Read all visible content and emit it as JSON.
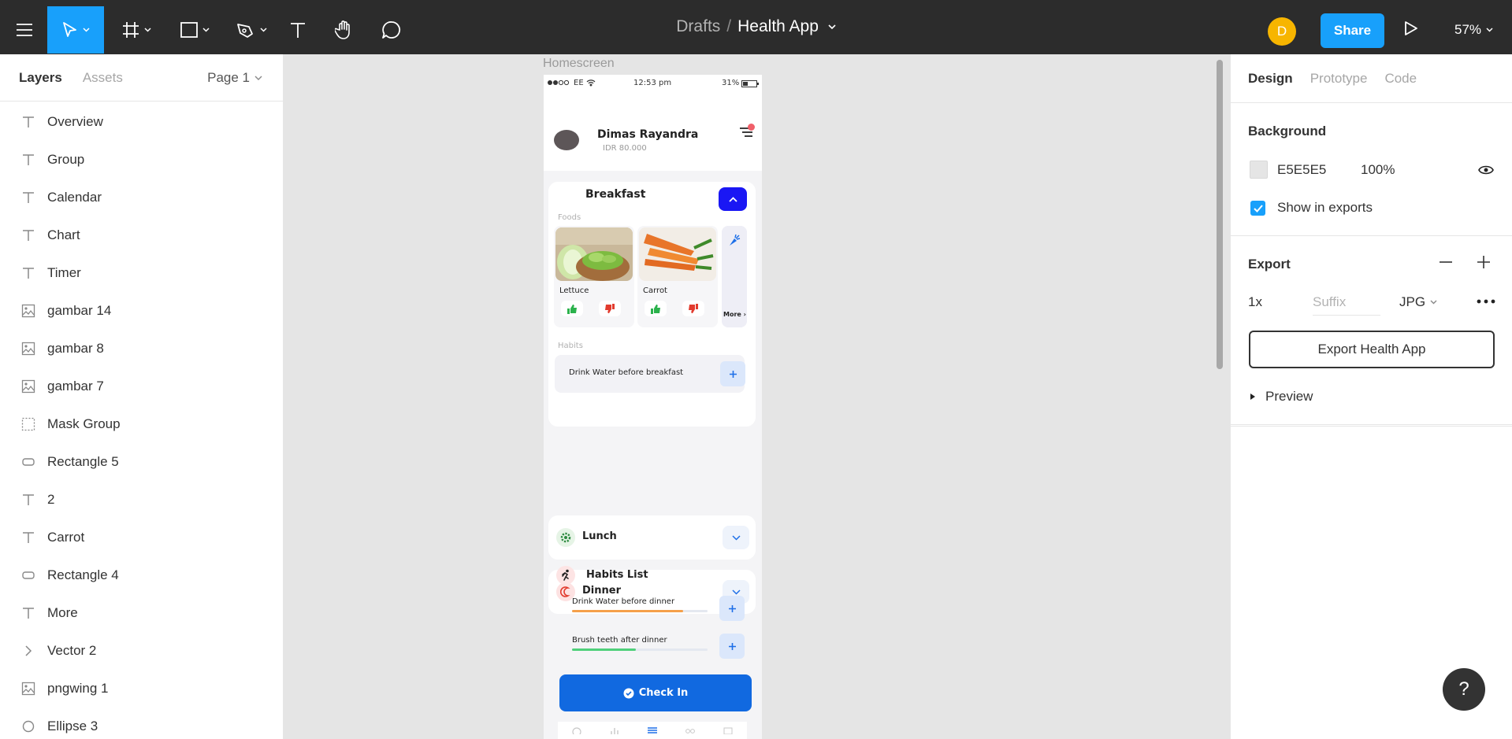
{
  "toolbar": {
    "breadcrumb_parent": "Drafts",
    "separator": "/",
    "file_name": "Health App",
    "avatar_initial": "D",
    "share_label": "Share",
    "zoom": "57%",
    "accent": "#18a0fb",
    "background": "#2c2c2c"
  },
  "left_panel": {
    "tabs": [
      "Layers",
      "Assets"
    ],
    "page_selector": "Page 1",
    "layers": [
      {
        "icon": "text-icon",
        "name": "Overview"
      },
      {
        "icon": "text-icon",
        "name": "Group"
      },
      {
        "icon": "text-icon",
        "name": "Calendar"
      },
      {
        "icon": "text-icon",
        "name": "Chart"
      },
      {
        "icon": "text-icon",
        "name": "Timer"
      },
      {
        "icon": "image-icon",
        "name": "gambar 14"
      },
      {
        "icon": "image-icon",
        "name": "gambar 8"
      },
      {
        "icon": "image-icon",
        "name": "gambar 7"
      },
      {
        "icon": "mask-group-icon",
        "name": "Mask Group"
      },
      {
        "icon": "rectangle-icon",
        "name": "Rectangle 5"
      },
      {
        "icon": "text-icon",
        "name": "2"
      },
      {
        "icon": "text-icon",
        "name": "Carrot"
      },
      {
        "icon": "rectangle-icon",
        "name": "Rectangle 4"
      },
      {
        "icon": "text-icon",
        "name": "More"
      },
      {
        "icon": "vector-icon",
        "name": "Vector 2"
      },
      {
        "icon": "image-icon",
        "name": "pngwing 1"
      },
      {
        "icon": "ellipse-icon",
        "name": "Ellipse 3"
      }
    ]
  },
  "canvas": {
    "frame_label": "Homescreen",
    "background": "#e5e5e5"
  },
  "phone": {
    "status": {
      "carrier": "EE",
      "time": "12:53 pm",
      "battery": "31%"
    },
    "user": {
      "name": "Dimas Rayandra",
      "balance": "IDR 80.000"
    },
    "breakfast": {
      "title": "Breakfast",
      "foods_label": "Foods",
      "foods": [
        {
          "name": "Lettuce"
        },
        {
          "name": "Carrot"
        }
      ],
      "more_label": "More ›",
      "habits_label": "Habits",
      "habit": "Drink Water before breakfast"
    },
    "meals": [
      {
        "title": "Lunch",
        "icon": "gear-icon"
      },
      {
        "title": "Dinner",
        "icon": "moon-icon"
      }
    ],
    "habits_list": {
      "title": "Habits List",
      "items": [
        {
          "label": "Drink Water before dinner",
          "progress": 0.82,
          "color": "#f5a04a"
        },
        {
          "label": "Brush teeth after dinner",
          "progress": 0.47,
          "color": "#4fd07a"
        }
      ]
    },
    "checkin_label": "Check In",
    "colors": {
      "primary": "#1169e0",
      "collapse": "#1a17f4",
      "like": "#2bb24c",
      "dislike": "#e23b2e"
    }
  },
  "right_panel": {
    "tabs": [
      "Design",
      "Prototype",
      "Code"
    ],
    "background": {
      "title": "Background",
      "hex": "E5E5E5",
      "opacity": "100%",
      "show_in_exports": "Show in exports"
    },
    "export": {
      "title": "Export",
      "scale": "1x",
      "suffix_placeholder": "Suffix",
      "format": "JPG",
      "button_label": "Export Health App",
      "preview_label": "Preview"
    }
  },
  "help_label": "?"
}
